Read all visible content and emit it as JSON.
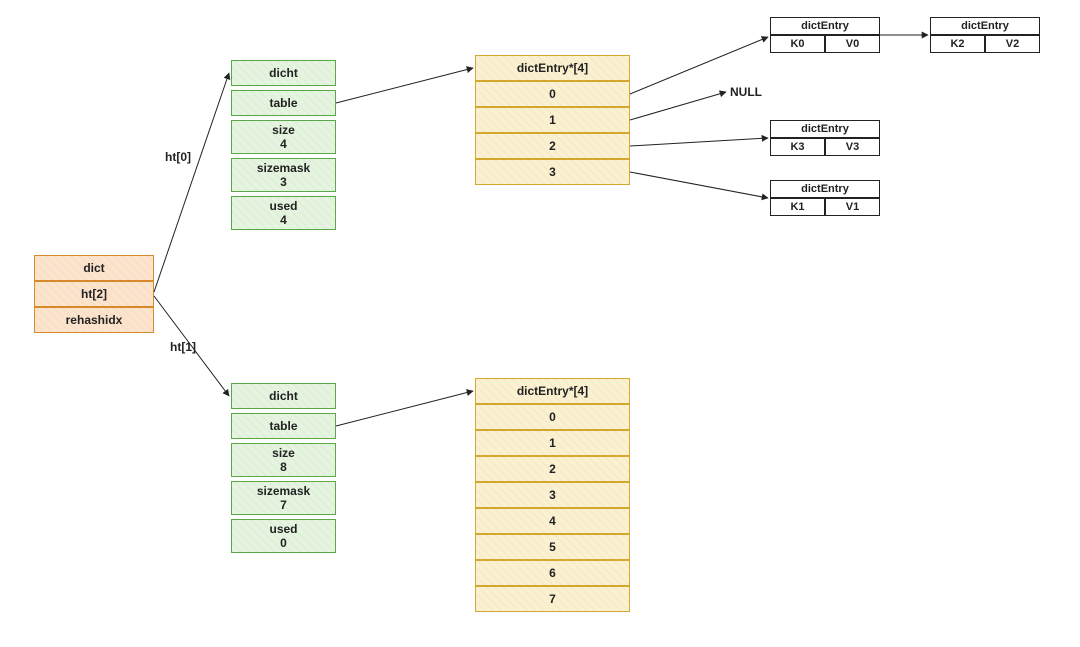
{
  "dict": {
    "title": "dict",
    "ht_field": "ht[2]",
    "rehashidx_field": "rehashidx"
  },
  "ht0": {
    "edge_label": "ht[0]",
    "title": "dicht",
    "table_field": "table",
    "size_label": "size",
    "size_value": "4",
    "sizemask_label": "sizemask",
    "sizemask_value": "3",
    "used_label": "used",
    "used_value": "4"
  },
  "ht1": {
    "edge_label": "ht[1]",
    "title": "dicht",
    "table_field": "table",
    "size_label": "size",
    "size_value": "8",
    "sizemask_label": "sizemask",
    "sizemask_value": "7",
    "used_label": "used",
    "used_value": "0"
  },
  "table0": {
    "header": "dictEntry*[4]",
    "slots": [
      "0",
      "1",
      "2",
      "3"
    ],
    "null_label": "NULL",
    "entries": [
      {
        "title": "dictEntry",
        "k": "K0",
        "v": "V0"
      },
      {
        "title": "dictEntry",
        "k": "K2",
        "v": "V2"
      },
      {
        "title": "dictEntry",
        "k": "K3",
        "v": "V3"
      },
      {
        "title": "dictEntry",
        "k": "K1",
        "v": "V1"
      }
    ]
  },
  "table1": {
    "header": "dictEntry*[4]",
    "slots": [
      "0",
      "1",
      "2",
      "3",
      "4",
      "5",
      "6",
      "7"
    ]
  }
}
